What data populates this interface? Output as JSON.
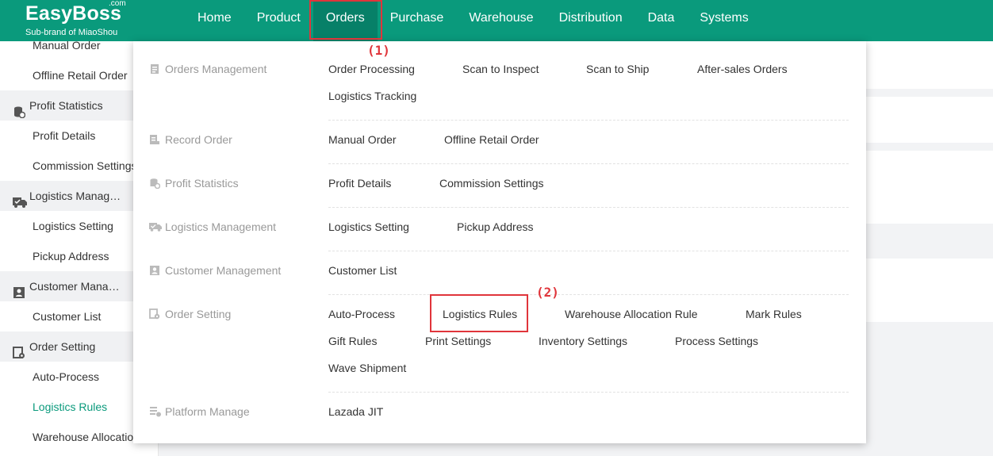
{
  "logo": {
    "name": "EasyBoss",
    "com": ".com",
    "sub": "Sub-brand of MiaoShou"
  },
  "nav": [
    "Home",
    "Product",
    "Orders",
    "Purchase",
    "Warehouse",
    "Distribution",
    "Data",
    "Systems"
  ],
  "sidebar": {
    "items": [
      {
        "type": "item",
        "label": "Manual Order"
      },
      {
        "type": "item",
        "label": "Offline Retail Order"
      },
      {
        "type": "group",
        "label": "Profit Statistics",
        "icon": "coins-icon"
      },
      {
        "type": "item",
        "label": "Profit Details"
      },
      {
        "type": "item",
        "label": "Commission Settings"
      },
      {
        "type": "group",
        "label": "Logistics Manag…",
        "icon": "truck-icon"
      },
      {
        "type": "item",
        "label": "Logistics Setting"
      },
      {
        "type": "item",
        "label": "Pickup Address"
      },
      {
        "type": "group",
        "label": "Customer Mana…",
        "icon": "contacts-icon"
      },
      {
        "type": "item",
        "label": "Customer List"
      },
      {
        "type": "group",
        "label": "Order Setting",
        "icon": "order-gear-icon"
      },
      {
        "type": "item",
        "label": "Auto-Process"
      },
      {
        "type": "item",
        "label": "Logistics Rules",
        "active": true
      },
      {
        "type": "item",
        "label": "Warehouse Allocation"
      }
    ]
  },
  "menu": {
    "categories": [
      {
        "label": "Orders Management",
        "icon": "clipboard-icon",
        "links": [
          "Order Processing",
          "Scan to Inspect",
          "Scan to Ship",
          "After-sales Orders",
          "Logistics Tracking"
        ]
      },
      {
        "label": "Record Order",
        "icon": "record-icon",
        "links": [
          "Manual Order",
          "Offline Retail Order"
        ]
      },
      {
        "label": "Profit Statistics",
        "icon": "coins-icon",
        "links": [
          "Profit Details",
          "Commission Settings"
        ]
      },
      {
        "label": "Logistics Management",
        "icon": "truck-icon",
        "links": [
          "Logistics Setting",
          "Pickup Address"
        ]
      },
      {
        "label": "Customer Management",
        "icon": "contacts-icon",
        "links": [
          "Customer List"
        ]
      },
      {
        "label": "Order Setting",
        "icon": "order-gear-icon",
        "links": [
          "Auto-Process",
          "Logistics Rules",
          "Warehouse Allocation Rule",
          "Mark Rules",
          "Gift Rules",
          "Print Settings",
          "Inventory Settings",
          "Process Settings",
          "Wave Shipment"
        ]
      },
      {
        "label": "Platform Manage",
        "icon": "platform-icon",
        "links": [
          "Lazada JIT"
        ]
      }
    ]
  },
  "annotations": [
    "(1)",
    "(2)"
  ],
  "colors": {
    "brand": "#0a9a7c",
    "nav_active": "#078068",
    "annotation": "#e0353b"
  }
}
